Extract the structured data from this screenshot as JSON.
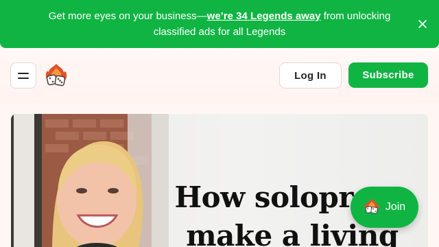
{
  "banner": {
    "text_before": "Get more eyes on your business—",
    "link": "we’re 34 Legends away",
    "text_after": " from unlocking classified ads for all Legends",
    "close_icon": "close-icon"
  },
  "header": {
    "menu_icon": "menu-icon",
    "logo_icon": "fire-dice-logo-icon",
    "login_label": "Log In",
    "subscribe_label": "Subscribe"
  },
  "hero": {
    "title_line1": "How soloprene",
    "title_line2": "make a living"
  },
  "join": {
    "label": "Join",
    "icon": "fire-dice-logo-icon"
  },
  "colors": {
    "brand_green": "#10b443",
    "background": "#fff7f4"
  }
}
